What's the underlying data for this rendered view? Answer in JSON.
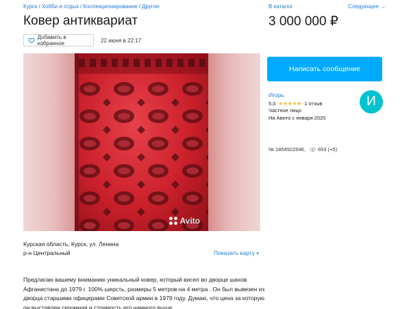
{
  "breadcrumbs": [
    "Курск",
    "Хобби и отдых",
    "Коллекционирование",
    "Другое"
  ],
  "breadcrumb_separator": "/",
  "nav": {
    "catalog": "В каталог",
    "next": "Следующее →"
  },
  "listing": {
    "title": "Ковер антиквариат",
    "price": "3 000 000 ₽",
    "favorite_label": "Добавить в избранное",
    "date": "22 июня в 22:17"
  },
  "gallery": {
    "watermark": "Avito"
  },
  "location": {
    "address": "Курская область, Курск, ул. Ленина",
    "district": "р-н Центральный",
    "show_map": "Показать карту"
  },
  "description": "Предлагаю вашему вниманию уникальный ковер, который висел во дворце шахов Афганистана до 1979 г. 100% шерсть, размеры 5 метров на 4 метра . Он был вывезен из дворца старшими офицерами Советской армии в 1979 году. Думаю, что цена за которую он выставлен скромная и стоимость его намного выше.",
  "seller": {
    "write_button": "Написать сообщение",
    "name": "Игорь",
    "rating": "5,0",
    "stars": "★★★★★",
    "reviews": "1 отзыв",
    "type": "Частное лицо",
    "since": "На Авито с января 2020",
    "avatar_letter": "И"
  },
  "stats": {
    "ad_id": "№ 1854922646,",
    "views": "653 (+5)"
  },
  "colors": {
    "accent": "#00aaff",
    "link": "#1f7ad4",
    "avatar": "#00c3cf",
    "star": "#ffb021"
  }
}
